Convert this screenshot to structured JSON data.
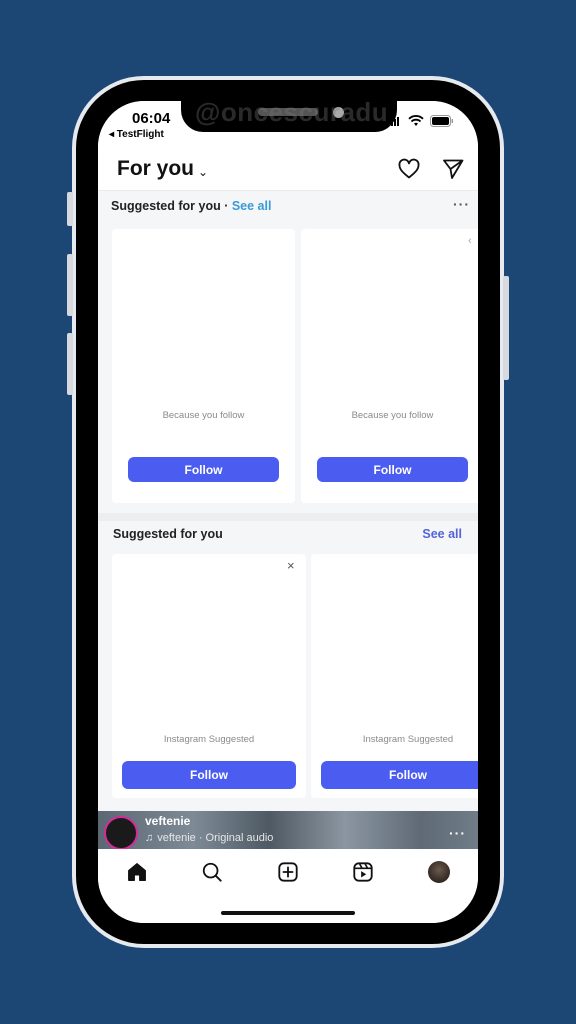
{
  "watermark": "@oncescuradu",
  "status_bar": {
    "time": "06:04",
    "back_app": "◂ TestFlight"
  },
  "header": {
    "title": "For you",
    "title_chevron": "⌄",
    "icons": [
      "heart-icon",
      "direct-message-icon"
    ]
  },
  "suggested_section_1": {
    "title": "Suggested for you",
    "separator": " · ",
    "see_all": "See all",
    "more": "···",
    "cards": [
      {
        "subtitle": "Because you follow",
        "button": "Follow"
      },
      {
        "subtitle": "Because you follow",
        "button": "Follow"
      }
    ]
  },
  "suggested_section_2": {
    "title": "Suggested for you",
    "see_all": "See all",
    "cards": [
      {
        "subtitle": "Instagram Suggested",
        "button": "Follow",
        "close": "×"
      },
      {
        "subtitle": "Instagram Suggested",
        "button": "Follow"
      }
    ]
  },
  "reel": {
    "username": "veftenie",
    "audio": "veftenie · Original audio",
    "more": "···"
  },
  "bottom_nav": {
    "items": [
      "home",
      "search",
      "create",
      "reels",
      "profile"
    ],
    "active": "home"
  },
  "colors": {
    "background": "#1c4673",
    "follow_button": "#4b5cf0",
    "see_all_1": "#3a9ad9",
    "see_all_2": "#5563d8"
  }
}
